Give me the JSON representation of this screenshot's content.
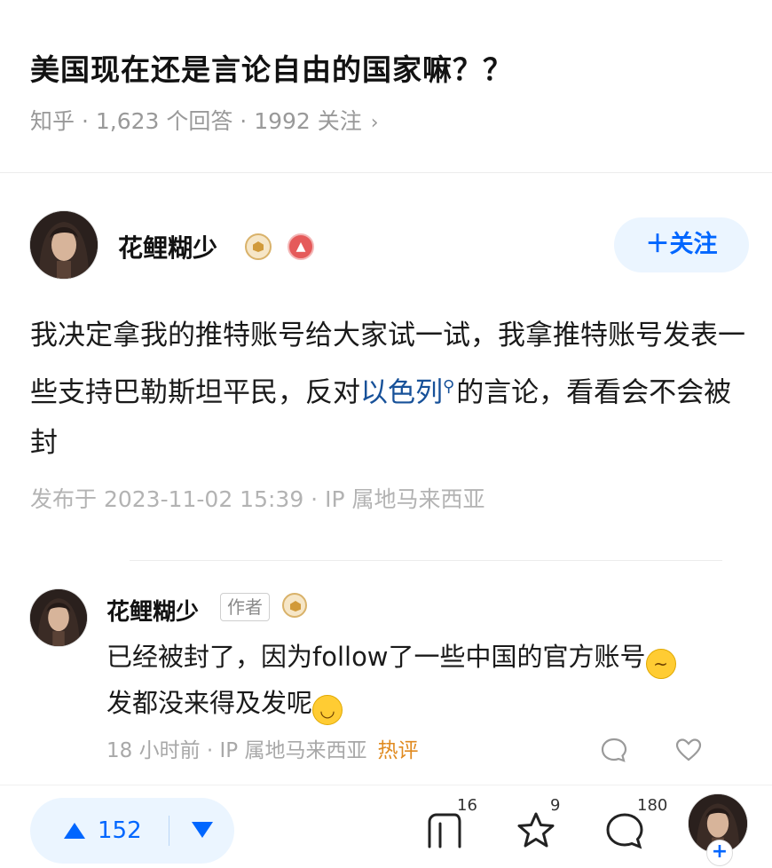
{
  "question": {
    "title": "美国现在还是言论自由的国家嘛？？",
    "meta": "知乎 · 1,623 个回答 · 1992 关注",
    "meta_chevron": "›"
  },
  "answer": {
    "author_name": "花鲤糊少",
    "follow_label": "＋关注",
    "text_before_link": "我决定拿我的推特账号给大家试一试，我拿推特账号发表一些支持巴勒斯坦平民，反对",
    "link_text": "以色列",
    "text_after_link": "的言论，看看会不会被封",
    "publish_meta": "发布于 2023-11-02 15:39 · IP 属地马来西亚"
  },
  "comment": {
    "author_name": "花鲤糊少",
    "author_tag": "作者",
    "text_line1": "已经被封了，因为follow了一些中国的官方账号",
    "text_line2": "发都没来得及发呢",
    "meta": "18 小时前 · IP 属地马来西亚",
    "hot_label": "热评"
  },
  "bottom_bar": {
    "upvotes": "152",
    "share_count": "16",
    "favorite_count": "9",
    "comment_count": "180",
    "avatar_plus": "+"
  },
  "icons": {
    "verified_badge": "crown-badge-icon",
    "red_badge": "thumb-badge-icon",
    "search_link": "search-icon",
    "reply": "comment-bubble-icon",
    "like": "heart-icon",
    "share": "share-icon",
    "favorite": "star-icon",
    "comment": "comment-icon"
  },
  "colors": {
    "accent_blue": "#0066ff",
    "link_blue": "#175199",
    "hot_orange": "#e08a1f"
  }
}
